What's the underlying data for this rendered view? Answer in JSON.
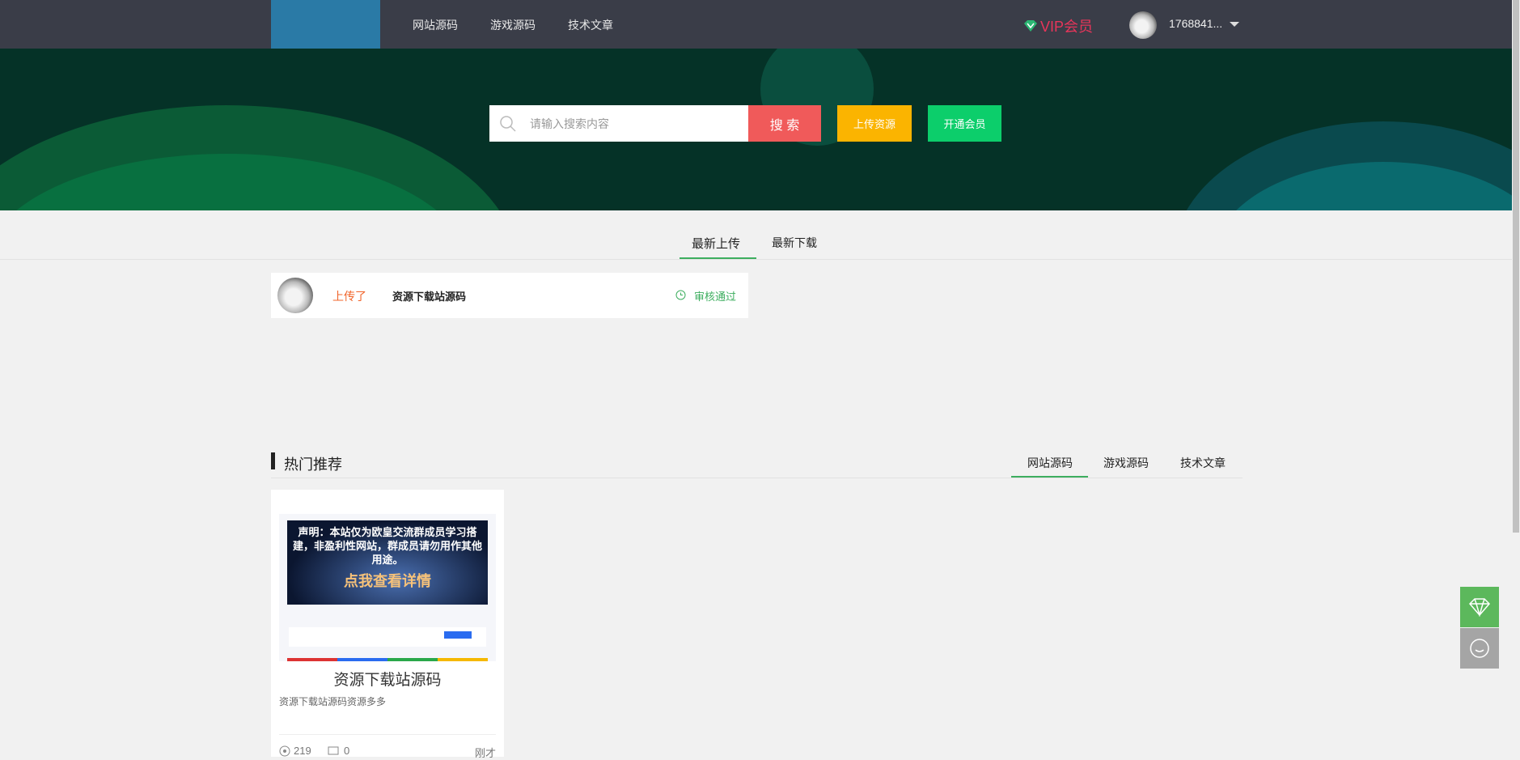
{
  "nav": {
    "links": [
      "网站源码",
      "游戏源码",
      "技术文章"
    ],
    "vip": "VIP会员",
    "username": "1768841..."
  },
  "banner": {
    "search_placeholder": "请输入搜索内容",
    "search_button": "搜 索",
    "upload_button": "上传资源",
    "member_button": "开通会员"
  },
  "feed": {
    "tabs": [
      "最新上传",
      "最新下载"
    ],
    "items": [
      {
        "action": "上传了",
        "title": "资源下载站源码",
        "status": "审核通过"
      }
    ]
  },
  "hot": {
    "title": "热门推荐",
    "tabs": [
      "网站源码",
      "游戏源码",
      "技术文章"
    ],
    "cards": [
      {
        "title": "资源下载站源码",
        "desc": "资源下载站源码资源多多",
        "views": "219",
        "comments": "0",
        "time": "刚才",
        "thumb_text_1": "声明：本站仅为欧皇交流群成员学习搭建，非盈利性网站，群成员请勿用作其他用途。",
        "thumb_text_2": "点我查看详情"
      }
    ]
  },
  "colors": {
    "nav": "#3a3d48",
    "accent_green": "#3dae5f",
    "search_btn": "#f05a5a",
    "upload_btn": "#fbb400",
    "member_btn": "#0cce6b",
    "vip": "#e8355a"
  }
}
